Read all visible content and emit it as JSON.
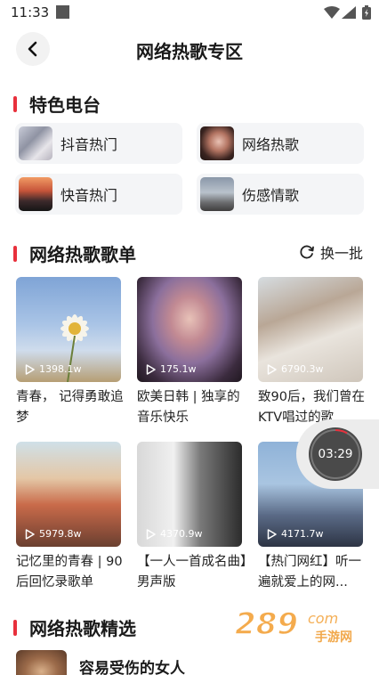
{
  "status_bar": {
    "time": "11:33"
  },
  "header": {
    "title": "网络热歌专区"
  },
  "featured_radio": {
    "title": "特色电台",
    "items": [
      {
        "label": "抖音热门"
      },
      {
        "label": "网络热歌"
      },
      {
        "label": "快音热门"
      },
      {
        "label": "伤感情歌"
      }
    ]
  },
  "playlists": {
    "title": "网络热歌歌单",
    "refresh_label": "换一批",
    "items": [
      {
        "plays": "1398.1w",
        "title": "青春， 记得勇敢追梦"
      },
      {
        "plays": "175.1w",
        "title": "欧美日韩 | 独享的音乐快乐"
      },
      {
        "plays": "6790.3w",
        "title": "致90后，我们曾在KTV唱过的歌"
      },
      {
        "plays": "5979.8w",
        "title": "记忆里的青春 | 90后回忆录歌单"
      },
      {
        "plays": "4370.9w",
        "title": "【一人一首成名曲】男声版"
      },
      {
        "plays": "4171.7w",
        "title": "【热门网红】听一遍就爱上的网..."
      }
    ]
  },
  "float_player": {
    "time": "03:29",
    "progress": 0.08
  },
  "selected_songs": {
    "title": "网络热歌精选",
    "items": [
      {
        "title": "容易受伤的女人"
      }
    ]
  },
  "watermark": {
    "text": "289",
    "sub": "手游网",
    "suffix": "com"
  },
  "colors": {
    "accent": "#e8303c",
    "card_bg": "#f4f5f7"
  }
}
